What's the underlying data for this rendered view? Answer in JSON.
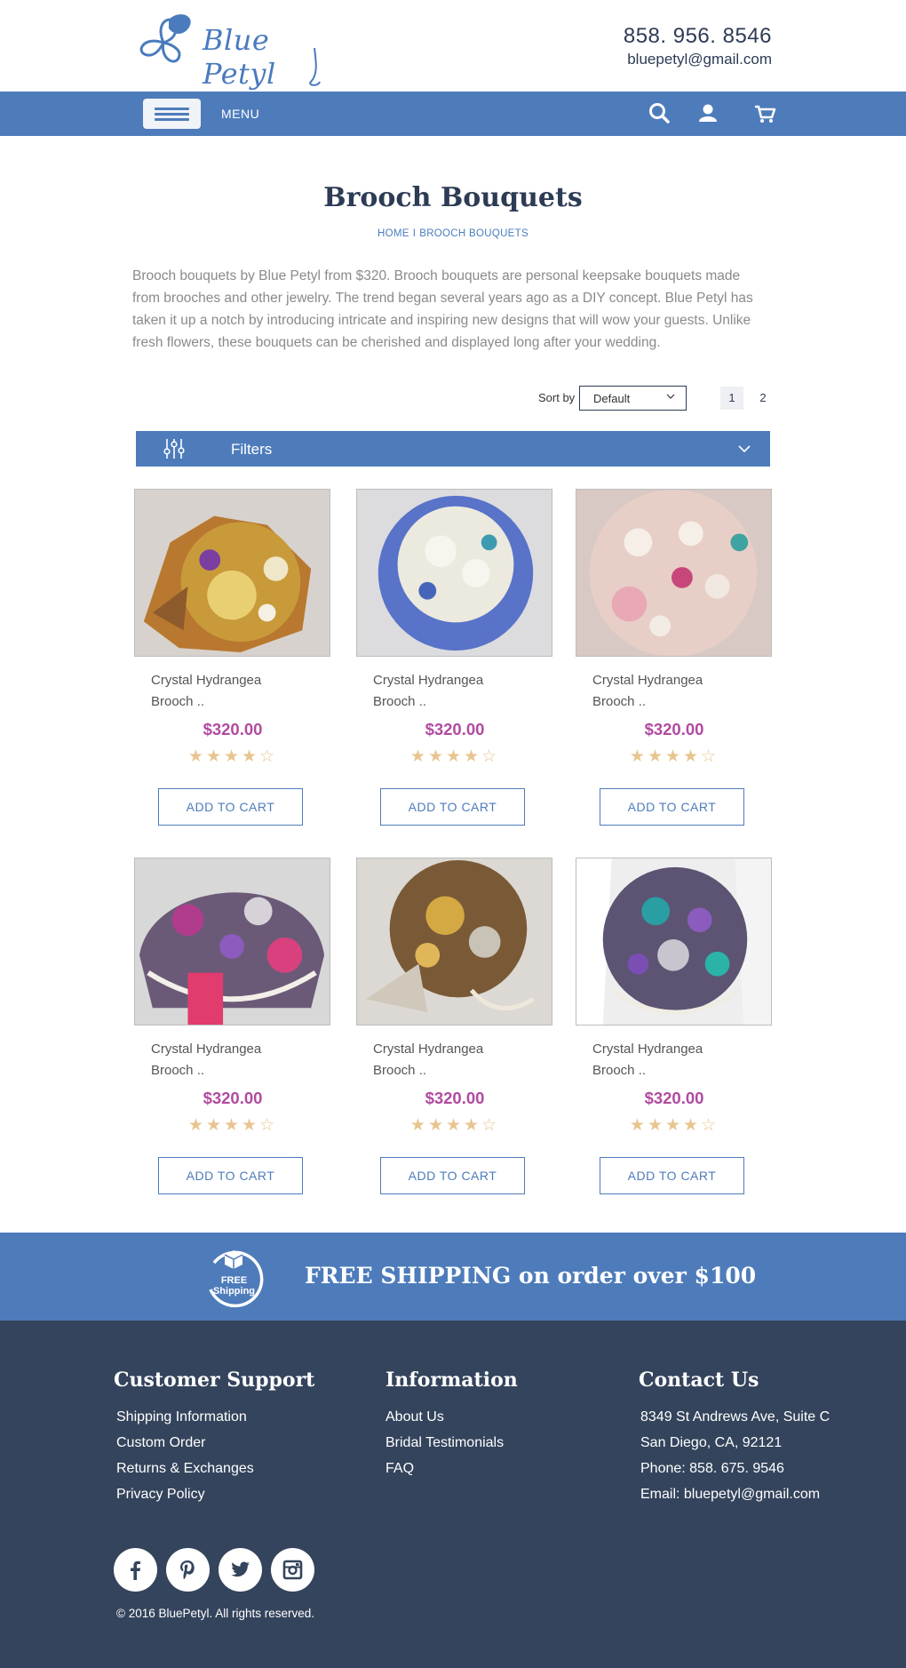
{
  "header": {
    "logo_text": "Blue Petyl",
    "phone": "858. 956. 8546",
    "email": "bluepetyl@gmail.com"
  },
  "nav": {
    "menu_label": "MENU",
    "icons": [
      "search-icon",
      "user-icon",
      "cart-icon"
    ]
  },
  "page": {
    "title": "Brooch Bouquets",
    "breadcrumb": [
      "HOME",
      "BROOCH BOUQUETS"
    ],
    "breadcrumb_sep": "I",
    "intro": "Brooch bouquets by Blue Petyl from $320. Brooch bouquets are personal keepsake bouquets made from brooches and other jewelry. The trend began several years ago as a DIY concept. Blue Petyl has taken it up a notch by introducing intricate and inspiring new designs that will wow your guests. Unlike fresh flowers, these bouquets can be cherished and displayed long after your wedding."
  },
  "sort": {
    "label": "Sort by",
    "selected": "Default"
  },
  "pagination": {
    "pages": [
      "1",
      "2"
    ],
    "current": "1"
  },
  "filters": {
    "label": "Filters"
  },
  "products": [
    {
      "name_line1": "Crystal Hydrangea",
      "name_line2": "Brooch ..",
      "price": "$320.00",
      "rating": 4,
      "max_rating": 5,
      "stars": "★★★★☆",
      "cart_label": "ADD TO CART"
    },
    {
      "name_line1": "Crystal Hydrangea",
      "name_line2": "Brooch ..",
      "price": "$320.00",
      "rating": 4,
      "max_rating": 5,
      "stars": "★★★★☆",
      "cart_label": "ADD TO CART"
    },
    {
      "name_line1": "Crystal Hydrangea",
      "name_line2": "Brooch ..",
      "price": "$320.00",
      "rating": 4,
      "max_rating": 5,
      "stars": "★★★★☆",
      "cart_label": "ADD TO CART"
    },
    {
      "name_line1": "Crystal Hydrangea",
      "name_line2": "Brooch ..",
      "price": "$320.00",
      "rating": 4,
      "max_rating": 5,
      "stars": "★★★★☆",
      "cart_label": "ADD TO CART"
    },
    {
      "name_line1": "Crystal Hydrangea",
      "name_line2": "Brooch ..",
      "price": "$320.00",
      "rating": 4,
      "max_rating": 5,
      "stars": "★★★★☆",
      "cart_label": "ADD TO CART"
    },
    {
      "name_line1": "Crystal Hydrangea",
      "name_line2": "Brooch ..",
      "price": "$320.00",
      "rating": 4,
      "max_rating": 5,
      "stars": "★★★★☆",
      "cart_label": "ADD TO CART"
    }
  ],
  "shipping": {
    "badge_line1": "FREE",
    "badge_line2": "Shipping",
    "text": "FREE SHIPPING on order over $100"
  },
  "footer": {
    "support": {
      "title": "Customer Support",
      "links": [
        "Shipping Information",
        "Custom Order",
        "Returns & Exchanges",
        "Privacy Policy"
      ]
    },
    "information": {
      "title": "Information",
      "links": [
        "About Us",
        "Bridal Testimonials",
        "FAQ"
      ]
    },
    "contact": {
      "title": "Contact Us",
      "lines": [
        "8349 St Andrews Ave, Suite C",
        "San Diego, CA, 92121",
        "Phone: 858. 675. 9546",
        "Email: bluepetyl@gmail.com"
      ]
    },
    "socials": [
      "facebook-icon",
      "pinterest-icon",
      "twitter-icon",
      "instagram-icon"
    ],
    "copyright": "©  2016 BluePetyl. All rights reserved."
  },
  "colors": {
    "brand_blue": "#4e7cbb",
    "footer_bg": "#34445c",
    "price": "#b14ba0",
    "stars": "#e8c590",
    "title": "#2d3b55"
  }
}
